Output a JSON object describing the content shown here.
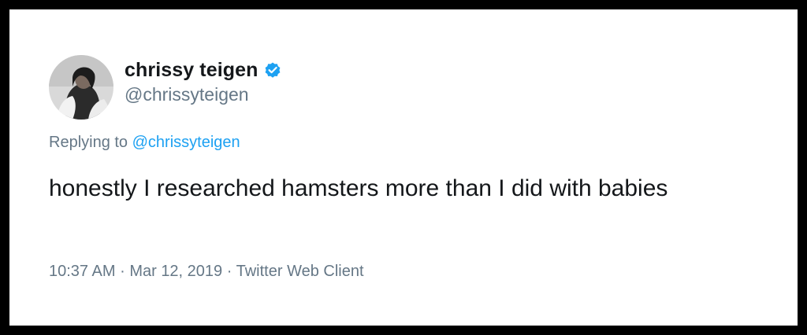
{
  "tweet": {
    "author": {
      "display_name": "chrissy teigen",
      "handle": "@chrissyteigen",
      "verified": true,
      "verified_icon": "verified-badge-icon",
      "avatar": "profile-photo"
    },
    "reply_prefix": "Replying to",
    "reply_to": "@chrissyteigen",
    "text": "honestly I researched hamsters more than I did with babies",
    "time": "10:37 AM",
    "date": "Mar 12, 2019",
    "separator": "·",
    "client": "Twitter Web Client"
  },
  "colors": {
    "frame": "#000000",
    "background": "#ffffff",
    "text_primary": "#14171a",
    "text_secondary": "#657786",
    "accent": "#1da1f2"
  }
}
